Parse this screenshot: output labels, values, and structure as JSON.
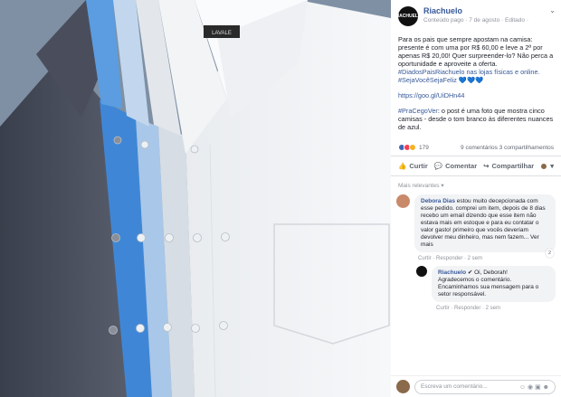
{
  "post": {
    "page_name": "Riachuelo",
    "logo_text": "RIACHUELO",
    "meta": "Conteúdo pago · 7 de agosto · Editado · ",
    "chevron": "⌄",
    "paragraph1": "Para os pais que sempre apostam na camisa: presente é com uma por R$ 60,00 e leve a 2ª por apenas R$ 20,00! Quer surpreender-lo? Não perca a oportunidade e aproveite a oferta.",
    "hashtags1": "#DiadosPaisRiachuelo nas lojas físicas e online. #SejaVocêSejaFeliz 💙💙💙",
    "link": "https://goo.gl/UiDHn44",
    "hashtag2": "#PraCegoVer",
    "paragraph2": ": o post é uma foto que mostra cinco camisas - desde o tom branco às diferentes nuances de azul."
  },
  "stats": {
    "reactions_count": "179",
    "comments_shares": "9 comentários  3 compartilhamentos"
  },
  "actions": {
    "like": "Curtir",
    "comment": "Comentar",
    "share": "Compartilhar"
  },
  "comments": {
    "filter": "Mais relevantes ▾",
    "c1_name": "Debora Dias",
    "c1_text": " estou muito decepcionada com esse pedido. comprei um item, depois de 8 dias recebo um email dizendo que esse item não estava mais em estoque e para eu contatar o valor gasto! primeiro que vocês deveriam devolver meu dinheiro, mas nem fazem... Ver mais",
    "c1_actions": "Curtir · Responder · 2 sem",
    "c1_count": "2",
    "r1_name": "Riachuelo",
    "r1_greeting": " ✔ Oi, Deborah!",
    "r1_text": "Agradecemos o comentário. Encaminhamos sua mensagem para o setor responsável.",
    "r1_actions": "Curtir · Responder · 2 sem",
    "write_placeholder": "Escreva um comentário...",
    "write_icons": "☺ ◉ ▣ ☻"
  },
  "colors": {
    "link": "#365899",
    "like_reaction": "#4267b2",
    "love_reaction": "#f33e58",
    "haha_reaction": "#f7b125"
  }
}
